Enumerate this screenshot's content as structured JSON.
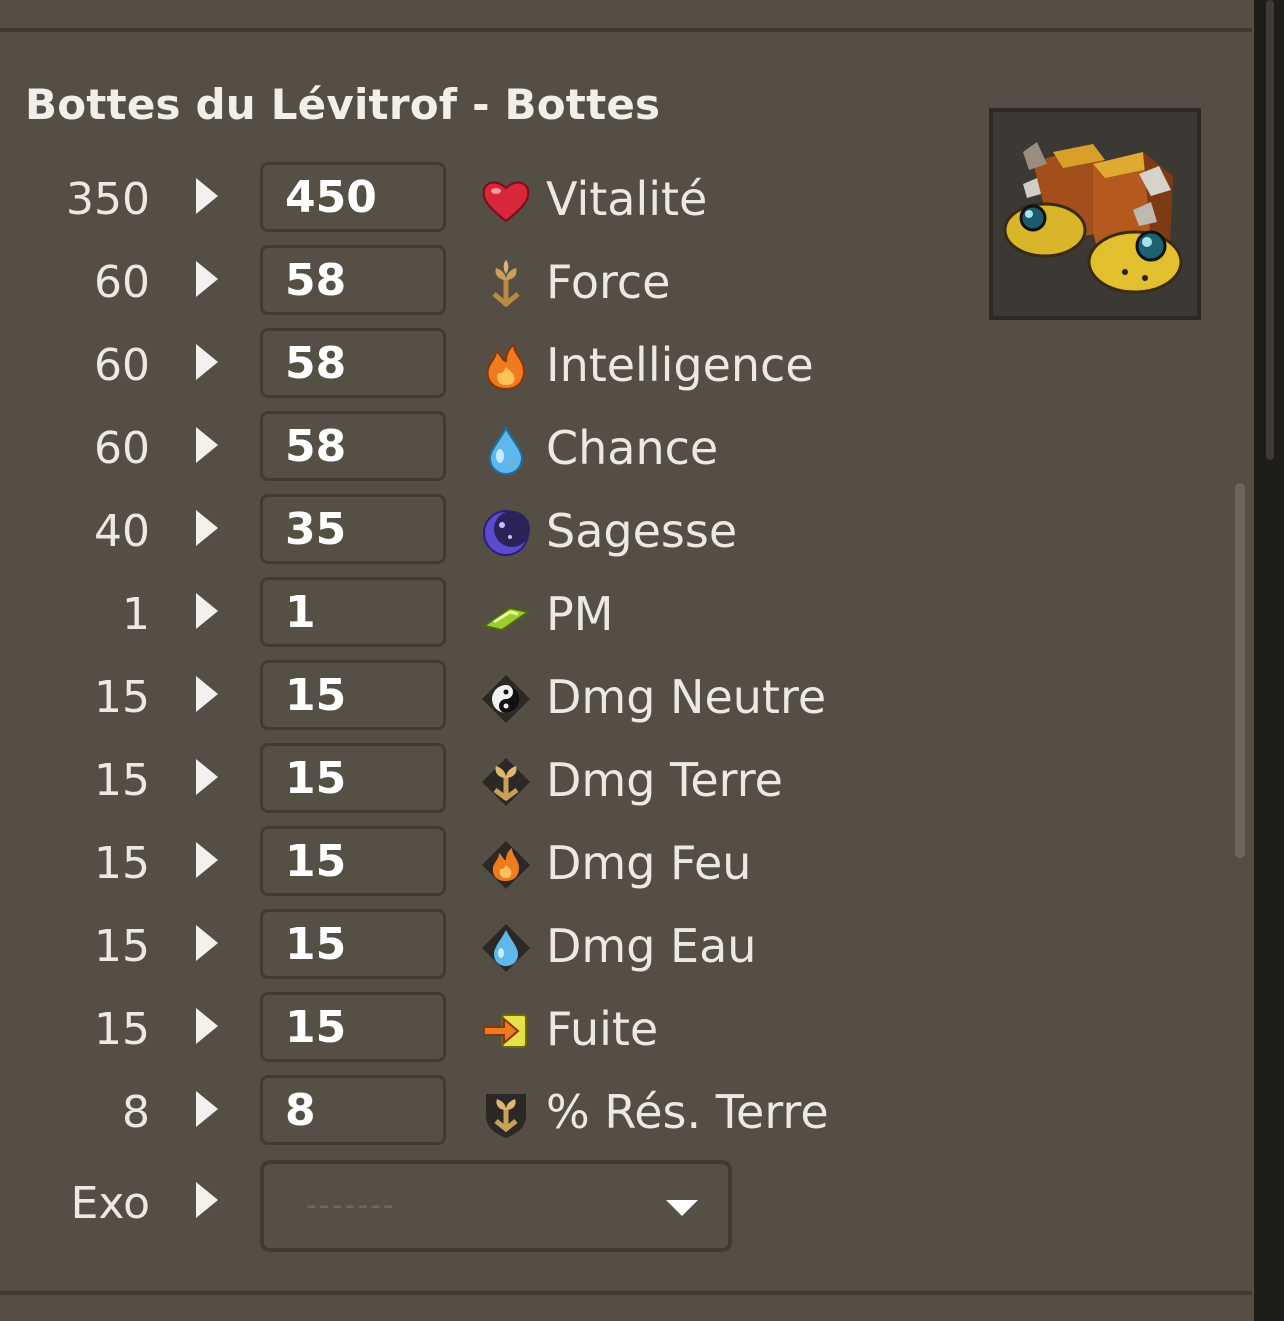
{
  "item": {
    "title": "Bottes du Lévitrof - Bottes",
    "image_icon": "boots-item-icon"
  },
  "stats": [
    {
      "base": "350",
      "value": "450",
      "label": "Vitalité",
      "icon": "heart-icon"
    },
    {
      "base": "60",
      "value": "58",
      "label": "Force",
      "icon": "earth-sprout-icon"
    },
    {
      "base": "60",
      "value": "58",
      "label": "Intelligence",
      "icon": "fire-icon"
    },
    {
      "base": "60",
      "value": "58",
      "label": "Chance",
      "icon": "water-drop-icon"
    },
    {
      "base": "40",
      "value": "35",
      "label": "Sagesse",
      "icon": "moon-icon"
    },
    {
      "base": "1",
      "value": "1",
      "label": "PM",
      "icon": "movement-points-icon"
    },
    {
      "base": "15",
      "value": "15",
      "label": "Dmg Neutre",
      "icon": "neutral-damage-icon"
    },
    {
      "base": "15",
      "value": "15",
      "label": "Dmg Terre",
      "icon": "earth-damage-icon"
    },
    {
      "base": "15",
      "value": "15",
      "label": "Dmg Feu",
      "icon": "fire-damage-icon"
    },
    {
      "base": "15",
      "value": "15",
      "label": "Dmg Eau",
      "icon": "water-damage-icon"
    },
    {
      "base": "15",
      "value": "15",
      "label": "Fuite",
      "icon": "flee-arrow-icon"
    },
    {
      "base": "8",
      "value": "8",
      "label": "% Rés. Terre",
      "icon": "earth-resistance-icon"
    }
  ],
  "exo": {
    "label": "Exo",
    "placeholder": "-------"
  },
  "colors": {
    "background": "#544e45",
    "text": "#ece9e4",
    "input_border": "#403b34"
  }
}
